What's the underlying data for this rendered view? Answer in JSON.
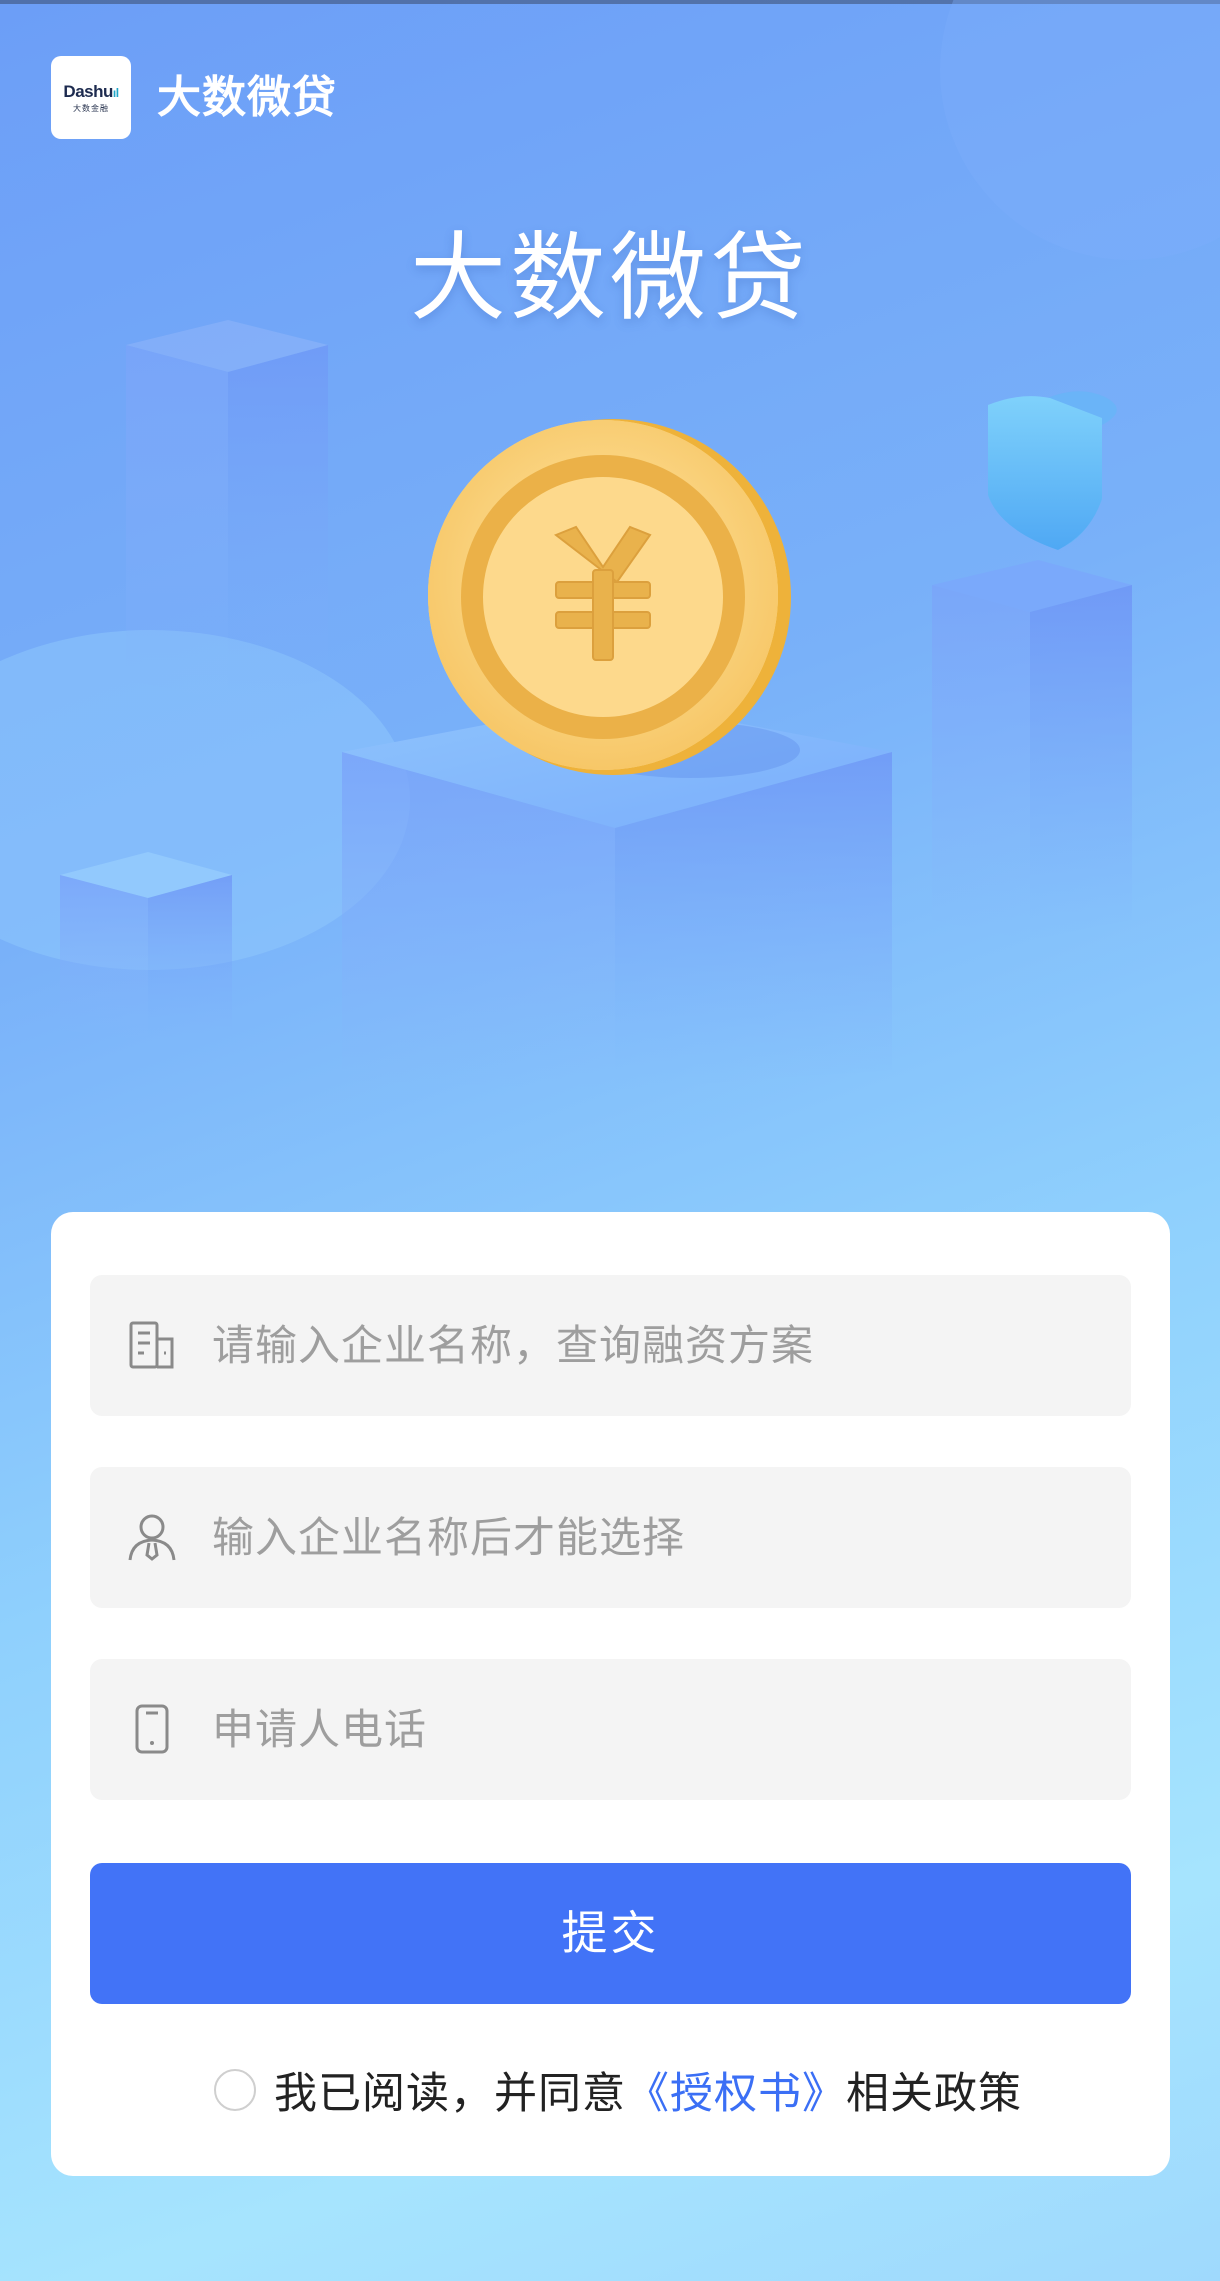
{
  "header": {
    "logo_word": "Dashu",
    "logo_sub": "大数金融",
    "app_name": "大数微贷"
  },
  "hero": {
    "title": "大数微贷",
    "coin_symbol": "¥"
  },
  "form": {
    "company_field": {
      "placeholder": "请输入企业名称，查询融资方案",
      "icon": "building-icon"
    },
    "person_field": {
      "placeholder": "输入企业名称后才能选择",
      "icon": "person-icon"
    },
    "phone_field": {
      "placeholder": "申请人电话",
      "icon": "phone-icon"
    },
    "submit_label": "提交",
    "agreement": {
      "prefix": "我已阅读，并同意",
      "link": "《授权书》",
      "suffix": "相关政策",
      "checked": false
    }
  },
  "colors": {
    "primary": "#4273f7",
    "link": "#3b6ff5",
    "field_bg": "#f4f4f4",
    "placeholder": "#9e9e9e",
    "coin_gold": "#f5c45a"
  }
}
